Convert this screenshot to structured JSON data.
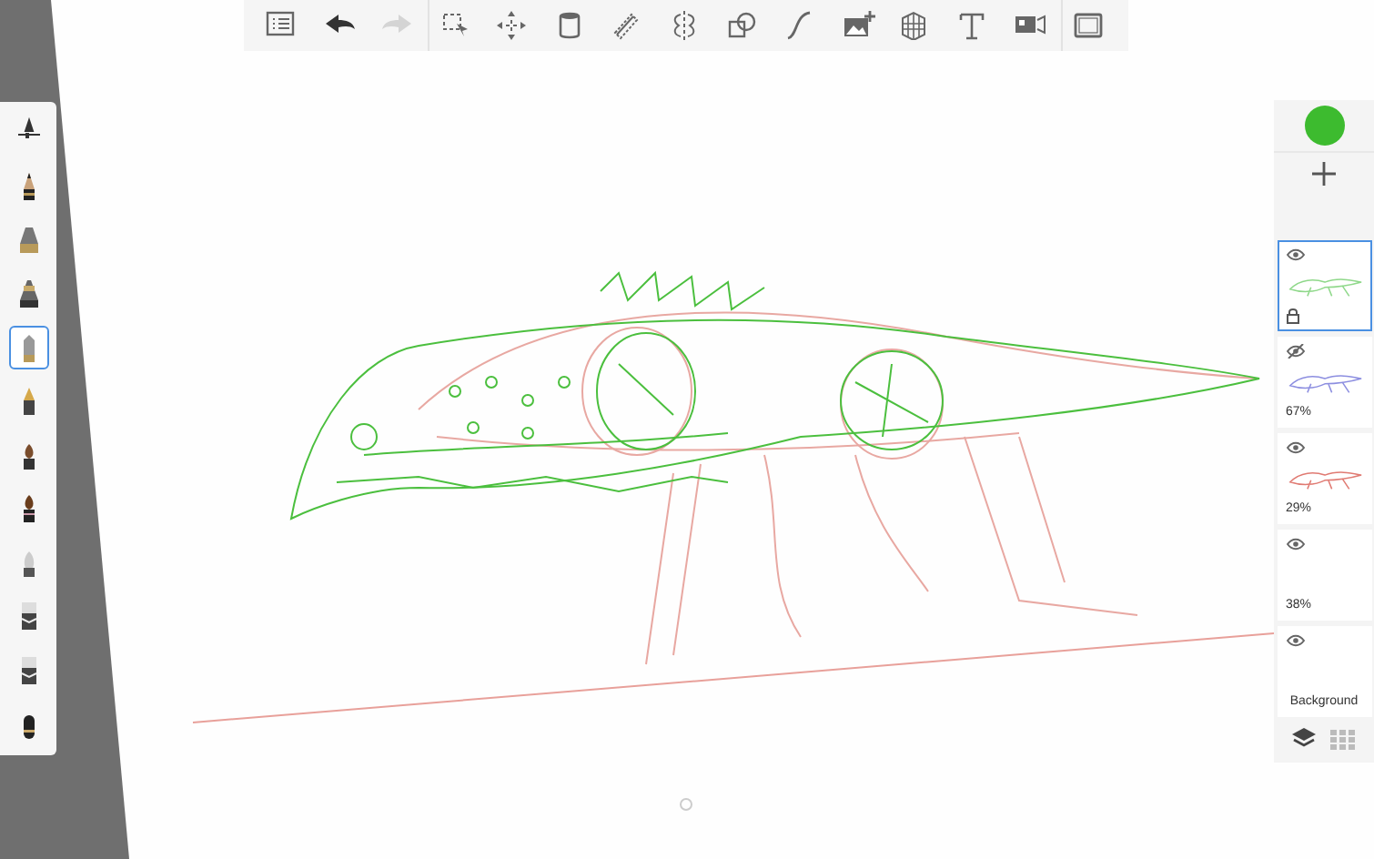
{
  "toolbar": {
    "items": [
      {
        "kind": "list",
        "disabled": false
      },
      {
        "kind": "undo",
        "disabled": false
      },
      {
        "kind": "redo",
        "disabled": true
      },
      {
        "kind": "select",
        "disabled": false
      },
      {
        "kind": "move",
        "disabled": false
      },
      {
        "kind": "fill",
        "disabled": false
      },
      {
        "kind": "ruler",
        "disabled": false
      },
      {
        "kind": "symmetry",
        "disabled": false
      },
      {
        "kind": "shapes",
        "disabled": false
      },
      {
        "kind": "curve",
        "disabled": false
      },
      {
        "kind": "image",
        "disabled": false
      },
      {
        "kind": "perspective",
        "disabled": false
      },
      {
        "kind": "text",
        "disabled": false
      },
      {
        "kind": "video",
        "disabled": false
      },
      {
        "kind": "fullscreen",
        "disabled": false
      }
    ]
  },
  "brushes": [
    {
      "kind": "settings",
      "selected": false
    },
    {
      "kind": "pencil",
      "selected": false
    },
    {
      "kind": "airbrush",
      "selected": false
    },
    {
      "kind": "marker",
      "selected": false
    },
    {
      "kind": "chisel",
      "selected": true
    },
    {
      "kind": "pen",
      "selected": false
    },
    {
      "kind": "brush",
      "selected": false
    },
    {
      "kind": "ink",
      "selected": false
    },
    {
      "kind": "soft",
      "selected": false
    },
    {
      "kind": "eraser",
      "selected": false
    },
    {
      "kind": "eraser",
      "selected": false
    },
    {
      "kind": "stamp",
      "selected": false
    }
  ],
  "color_puck": {
    "color": "#3dbb2f"
  },
  "layers": [
    {
      "visible": true,
      "selected": true,
      "locked": true,
      "color": "#8fd88a"
    },
    {
      "visible": false,
      "selected": false,
      "locked": false,
      "color": "#8c8ee0",
      "opacity": "67%"
    },
    {
      "visible": true,
      "selected": false,
      "locked": false,
      "color": "#e07a72",
      "opacity": "29%"
    },
    {
      "visible": true,
      "selected": false,
      "locked": false,
      "opacity": "38%"
    },
    {
      "visible": true,
      "selected": false,
      "locked": false,
      "label": "Background"
    }
  ]
}
